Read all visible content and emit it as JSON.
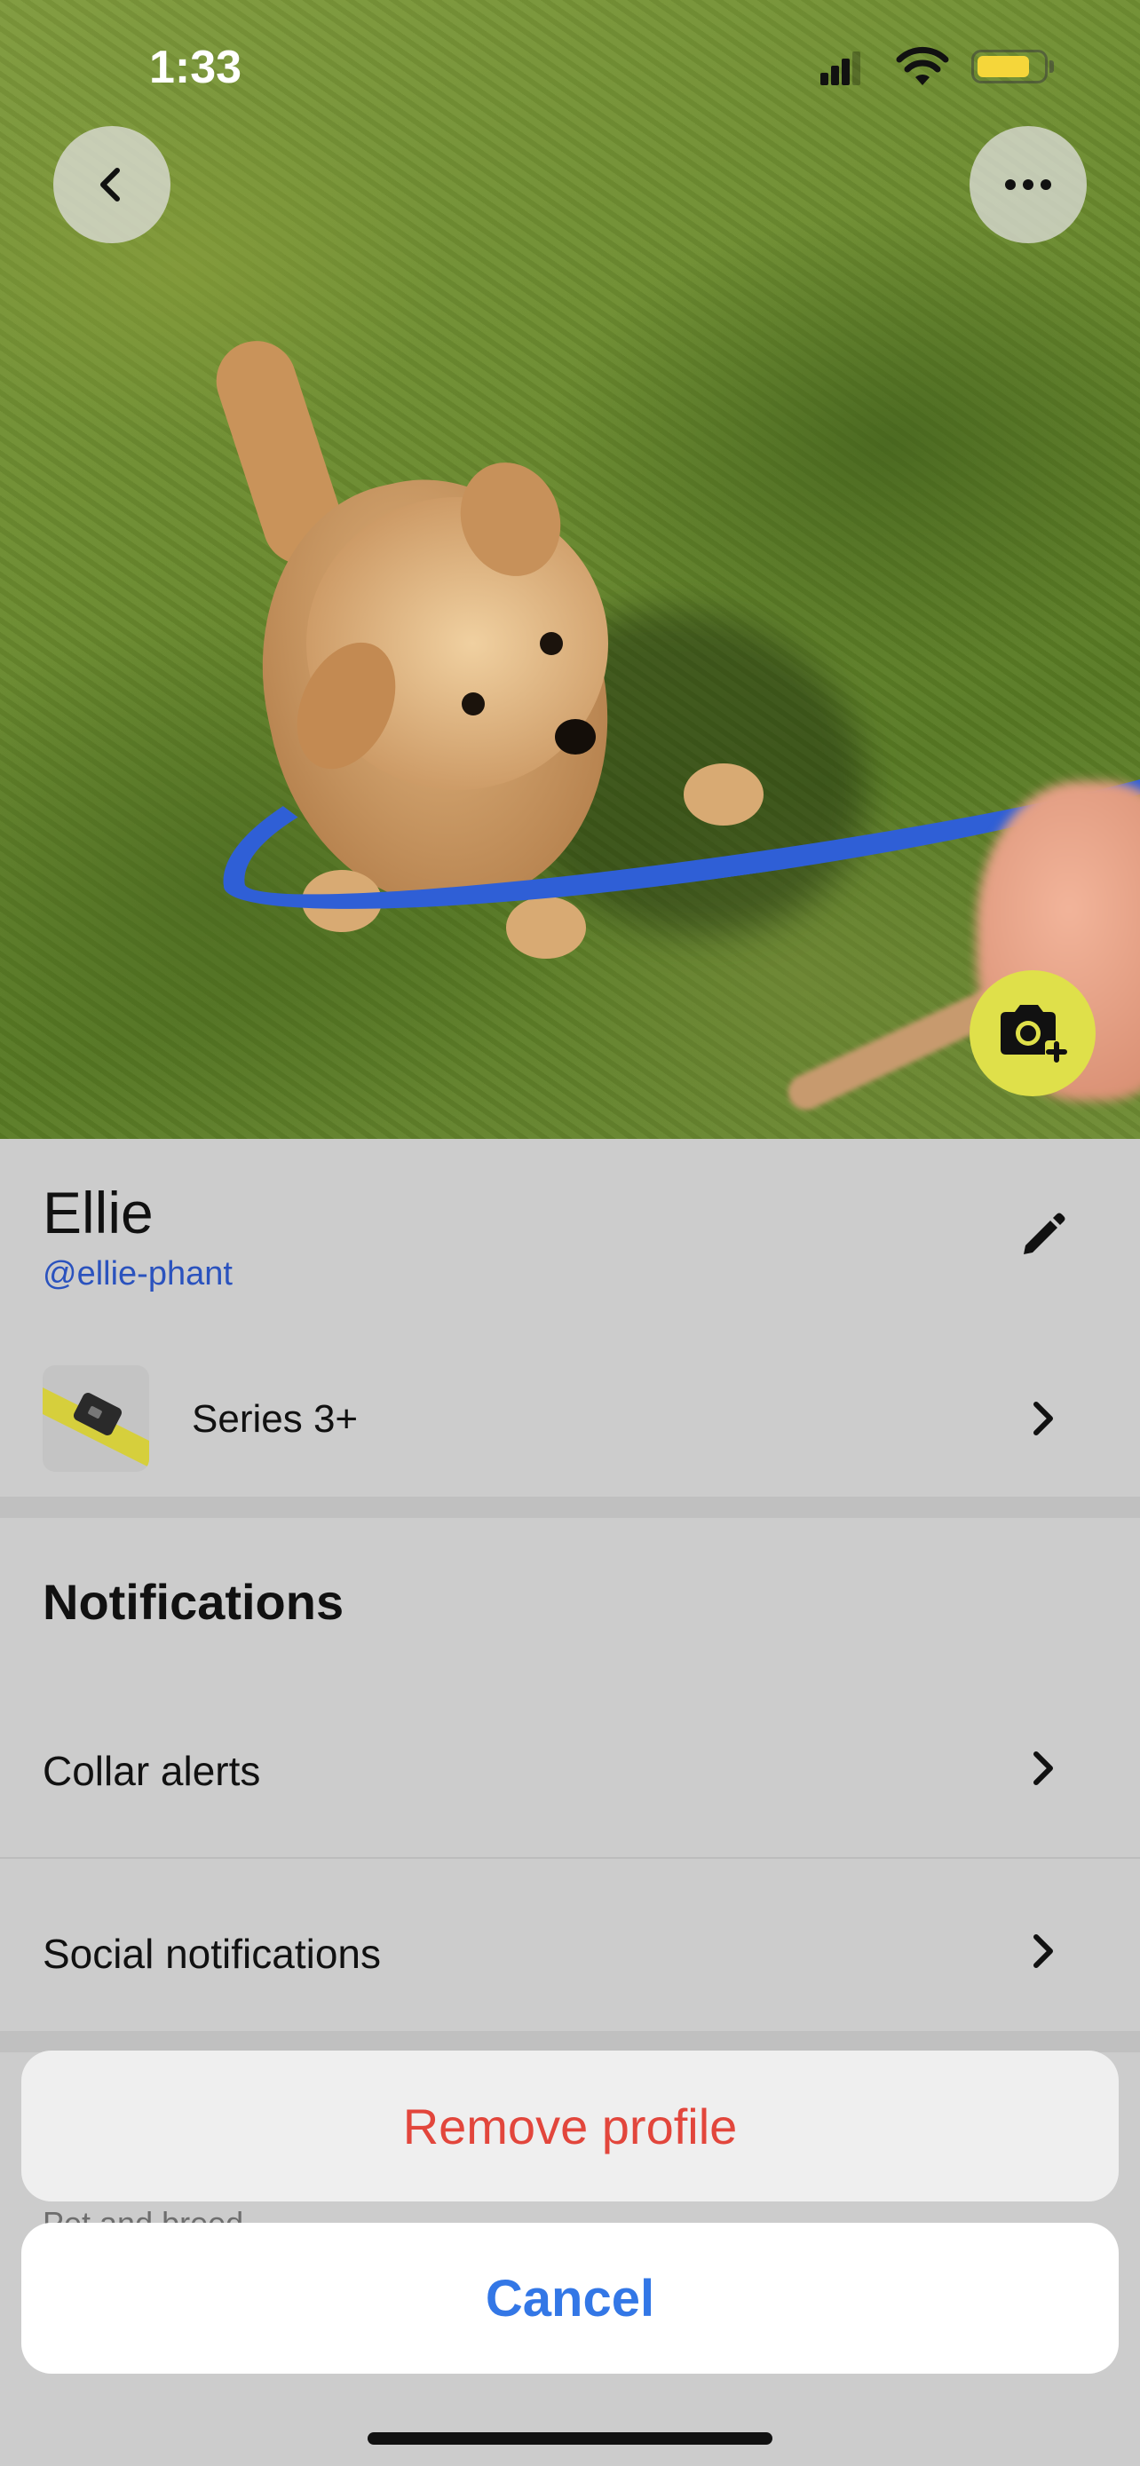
{
  "status_bar": {
    "time": "1:33",
    "battery_level": 0.78,
    "battery_color": "#f5d63a"
  },
  "header": {
    "back_icon": "chevron-left-icon",
    "more_icon": "ellipsis-icon",
    "camera_icon": "camera-plus-icon"
  },
  "profile": {
    "name": "Ellie",
    "handle": "@ellie-phant",
    "edit_icon": "pencil-icon"
  },
  "device": {
    "label": "Series 3+"
  },
  "notifications": {
    "title": "Notifications",
    "items": [
      {
        "label": "Collar alerts"
      },
      {
        "label": "Social notifications"
      }
    ]
  },
  "peek": {
    "label": "Pet and breed"
  },
  "action_sheet": {
    "remove_label": "Remove profile",
    "cancel_label": "Cancel"
  },
  "colors": {
    "accent_yellow": "#dfe04a",
    "handle_blue": "#2a52be",
    "destructive_red": "#e2463c",
    "cancel_blue": "#3377e6"
  }
}
